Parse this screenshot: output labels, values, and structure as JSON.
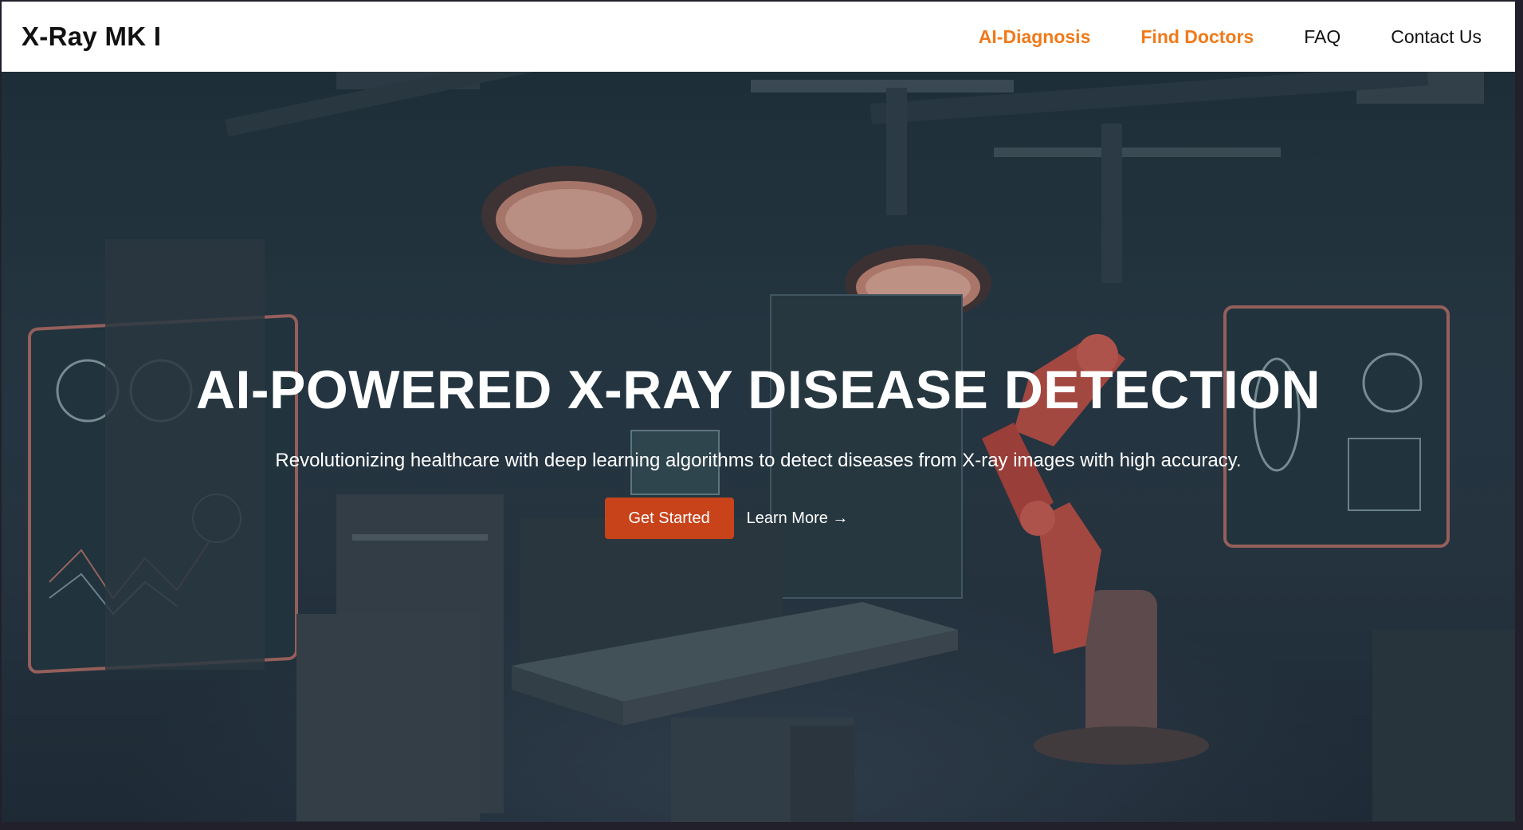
{
  "brand": {
    "name": "X-Ray MK I"
  },
  "nav": {
    "items": [
      {
        "label": "AI-Diagnosis",
        "accent": true
      },
      {
        "label": "Find Doctors",
        "accent": true
      },
      {
        "label": "FAQ",
        "accent": false
      },
      {
        "label": "Contact Us",
        "accent": false
      }
    ]
  },
  "hero": {
    "title": "AI-POWERED X-RAY DISEASE DETECTION",
    "subtitle": "Revolutionizing healthcare with deep learning algorithms to detect diseases from X-ray images with high accuracy.",
    "primary_cta": "Get Started",
    "secondary_cta": "Learn More →",
    "background_image": "hospital-operating-room-robot-arm-illustration"
  },
  "colors": {
    "accent": "#f07a1a",
    "button": "#c8431a",
    "nav_bg": "#ffffff"
  }
}
